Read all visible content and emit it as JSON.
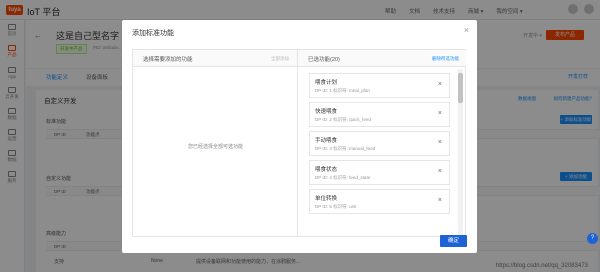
{
  "app": {
    "logo_text": "tuya",
    "title": "IoT 平台"
  },
  "top_menu": [
    "帮助",
    "文档",
    "技术支持",
    "商城 ▾",
    "我的空间 ▾"
  ],
  "sidebar": {
    "items": [
      "首页",
      "产品",
      "App",
      "云开发",
      "数据",
      "运营",
      "数据",
      "服务"
    ]
  },
  "page": {
    "title": "这是自己型名字",
    "status": "开发中产品",
    "pid": "PID: ambula...",
    "dev_label": "开发中 ▾",
    "publish_label": "发布产品"
  },
  "tabs": [
    "功能定义",
    "设备面板"
  ],
  "tab_right": "开发打样",
  "sections": {
    "custom_dev": "自定义开发",
    "custom_right_1": "数据视图",
    "custom_right_2": "如何新建产品功能？",
    "standard_funcs": "标准功能",
    "custom_funcs": "自定义功能",
    "advanced": "高级能力",
    "col_dp": "DP ID",
    "col_name": "功能点",
    "add_standard": "+ 添加标准功能",
    "add_custom": "+ 添加功能",
    "row_text": "支持",
    "row_sub": "None",
    "row_desc": "提供设备联网和功能使用的能力，在涂鸦服务..."
  },
  "modal": {
    "title": "添加标准功能",
    "left_header": "选择需要添加的功能",
    "left_header_right": "全部添加",
    "empty_text": "您已经选择全部可选功能",
    "right_header": "已选功能(20)",
    "right_header_link": "删除所选功能",
    "confirm": "确定",
    "items": [
      {
        "name": "喂食计划",
        "meta": "DP ID: 1   标识符: meal_plan"
      },
      {
        "name": "快速喂食",
        "meta": "DP ID: 2   标识符: quick_feed"
      },
      {
        "name": "手动喂食",
        "meta": "DP ID: 3   标识符: manual_feed"
      },
      {
        "name": "喂食状态",
        "meta": "DP ID: 4   标识符: feed_state"
      },
      {
        "name": "单位转换",
        "meta": "DP ID: 5   标识符: unit"
      }
    ]
  },
  "watermark": "https://blog.csdn.net/qq_32083473",
  "help_icon_text": "?"
}
